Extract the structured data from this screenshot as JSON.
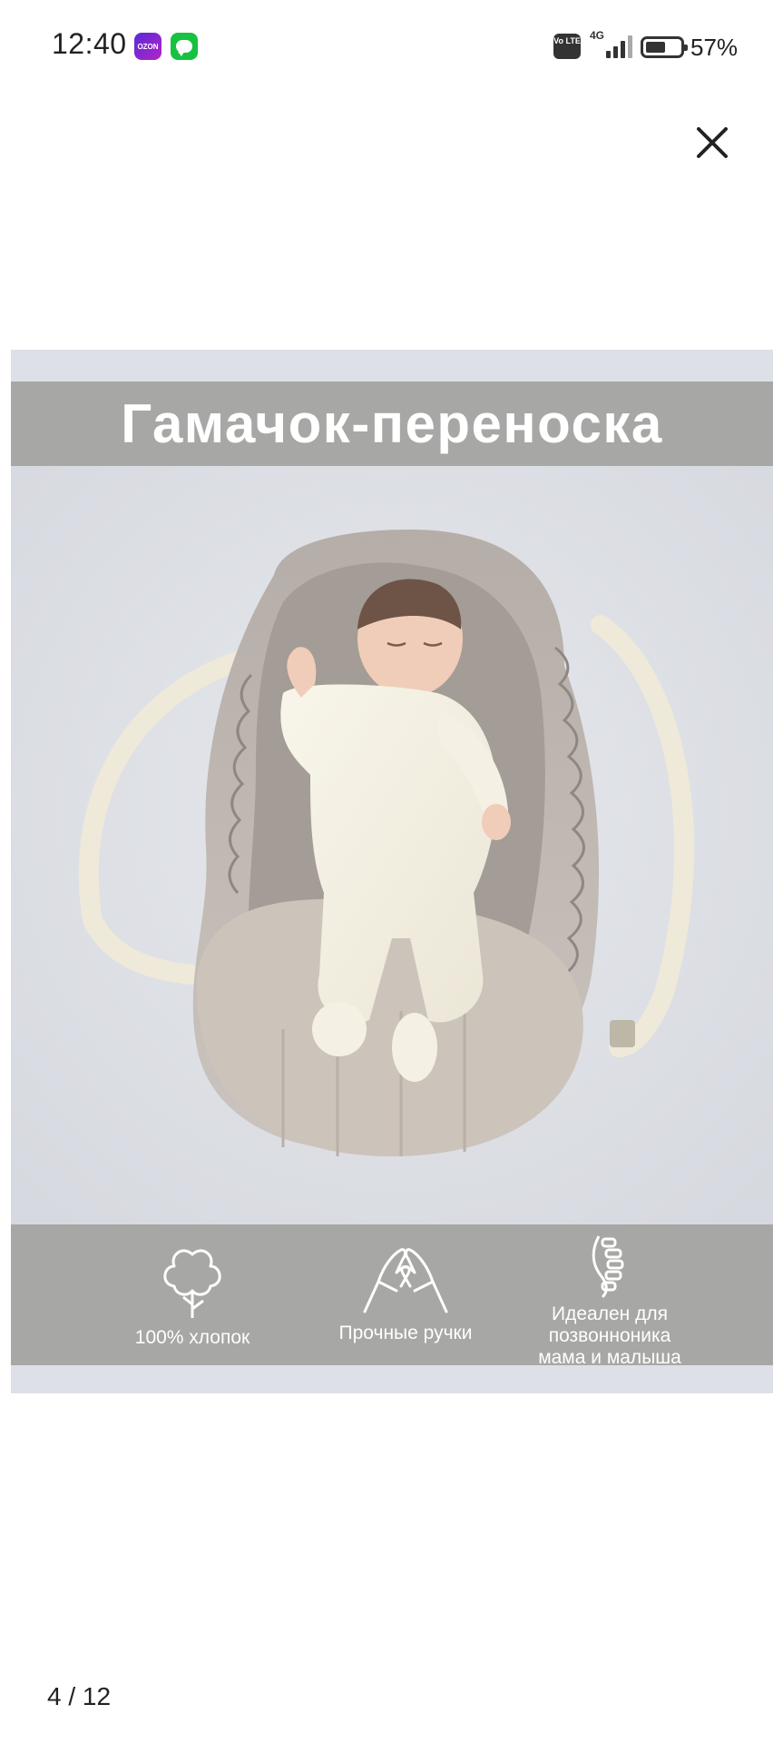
{
  "status_bar": {
    "time": "12:40",
    "ozon_icon_text": "OZON",
    "volte_text": "Vo LTE",
    "network": "4G",
    "battery_percent": "57%",
    "battery_level": 0.57
  },
  "viewer": {
    "close_icon": "close-icon",
    "page_indicator": "4 / 12"
  },
  "product_image": {
    "title": "Гамачок-переноска",
    "features": [
      {
        "icon": "cotton-icon",
        "label": "100% хлопок"
      },
      {
        "icon": "hands-icon",
        "label": "Прочные ручки"
      },
      {
        "icon": "spine-icon",
        "label": "Идеален для\nпозвонноника\nмама и малыша"
      }
    ]
  }
}
